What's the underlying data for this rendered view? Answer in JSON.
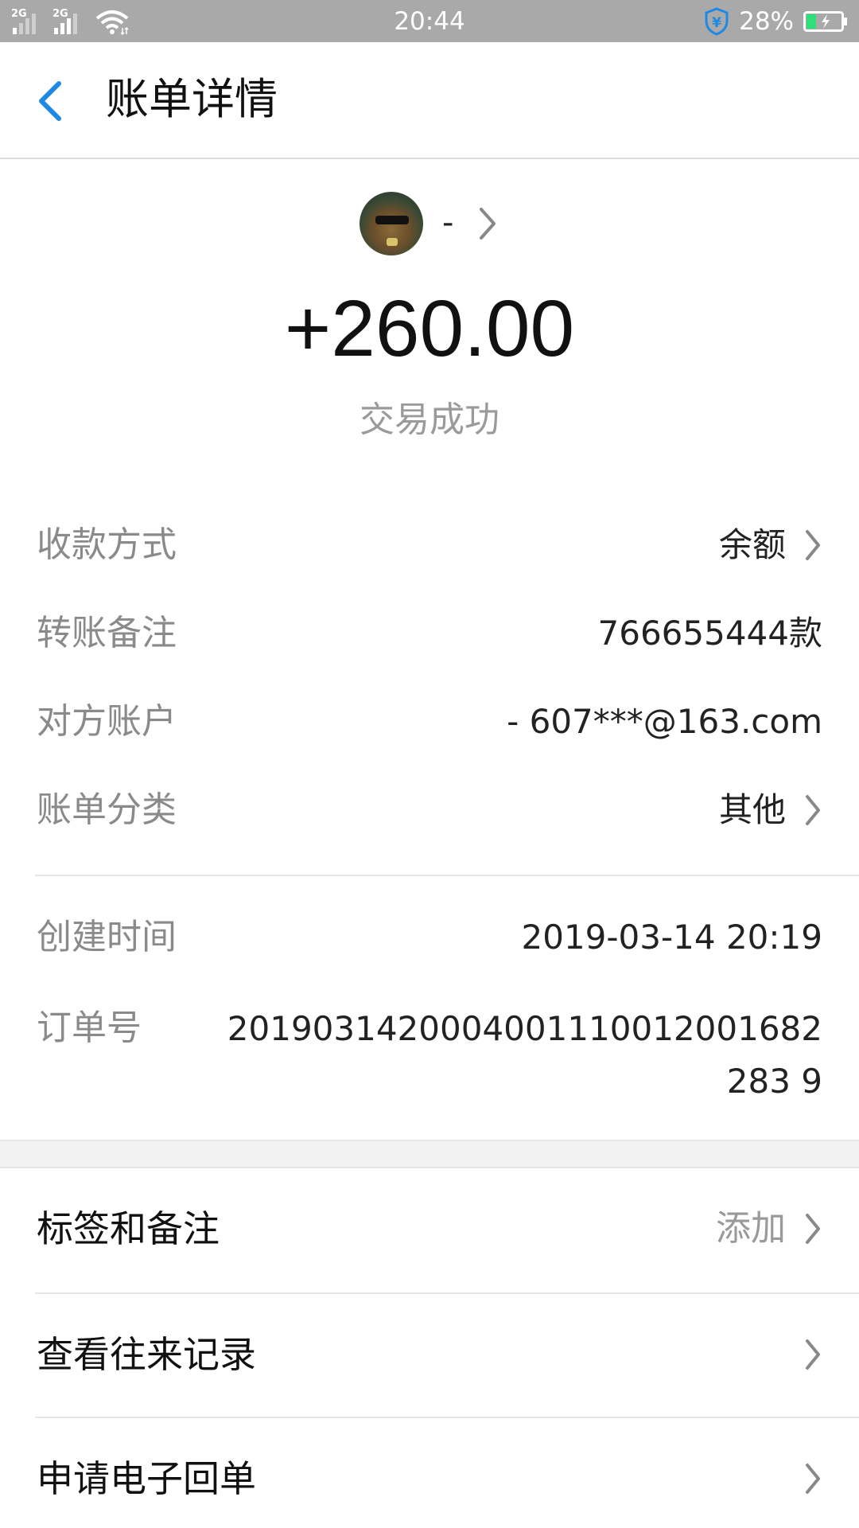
{
  "status_bar": {
    "signal1_label": "2G",
    "signal2_label": "2G",
    "time": "20:44",
    "battery_percent": "28%",
    "battery_level": 0.28,
    "shield_symbol": "¥"
  },
  "header": {
    "title": "账单详情"
  },
  "summary": {
    "payee_name": "-",
    "amount": "+260.00",
    "status": "交易成功"
  },
  "details": [
    {
      "label": "收款方式",
      "value": "余额",
      "chevron": true
    },
    {
      "label": "转账备注",
      "value": "766655444款",
      "chevron": false
    },
    {
      "label": "对方账户",
      "value": "- 607***@163.com",
      "chevron": false
    },
    {
      "label": "账单分类",
      "value": "其他",
      "chevron": true
    }
  ],
  "meta": {
    "created_label": "创建时间",
    "created_value": "2019-03-14 20:19",
    "order_label": "订单号",
    "order_value": "2019031420004001110012001682283 9"
  },
  "actions": [
    {
      "label": "标签和备注",
      "value": "添加"
    },
    {
      "label": "查看往来记录",
      "value": ""
    },
    {
      "label": "申请电子回单",
      "value": ""
    }
  ],
  "colors": {
    "accent": "#1e88e5",
    "status_bar": "#a9a9a9",
    "battery_fill": "#2ee07a",
    "muted_text": "#8a8a8a"
  }
}
